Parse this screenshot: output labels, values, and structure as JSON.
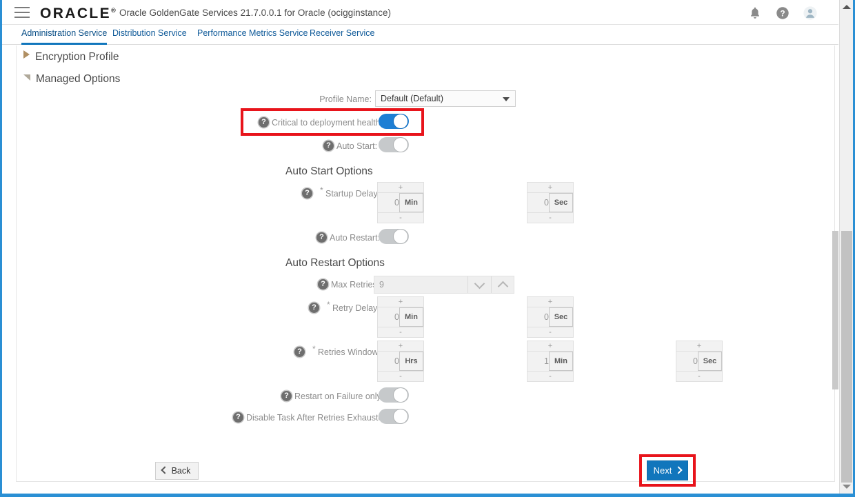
{
  "header": {
    "menu_icon": "hamburger-icon",
    "brand": "ORACLE",
    "brand_sup": "®",
    "title": "Oracle GoldenGate Services 21.7.0.0.1 for Oracle (ocigginstance)",
    "icons": [
      {
        "name": "notifications-bell-icon",
        "glyph": "bell"
      },
      {
        "name": "help-icon",
        "glyph": "question"
      },
      {
        "name": "user-avatar-icon",
        "glyph": "avatar"
      }
    ]
  },
  "tabs": [
    {
      "label": "Administration Service",
      "active": true
    },
    {
      "label": "Distribution Service",
      "active": false
    },
    {
      "label": "Performance Metrics Service",
      "active": false
    },
    {
      "label": "Receiver Service",
      "active": false
    }
  ],
  "accordions": [
    {
      "label": "Encryption Profile",
      "state": "collapsed"
    },
    {
      "label": "Managed Options",
      "state": "expanded"
    }
  ],
  "form": {
    "profile_name": {
      "label": "Profile Name:",
      "value": "Default (Default)"
    },
    "critical_health": {
      "label": "Critical to deployment health:",
      "state": "on"
    },
    "auto_start": {
      "label": "Auto Start:",
      "state": "off"
    },
    "auto_start_options": {
      "section_title": "Auto Start Options",
      "startup_delay": {
        "label": "Startup Delay:",
        "required": "*",
        "fields": [
          {
            "value": "0",
            "unit": "Min",
            "plus": "+",
            "minus": "-"
          },
          {
            "value": "0",
            "unit": "Sec",
            "plus": "+",
            "minus": "-"
          }
        ]
      },
      "auto_restart": {
        "label": "Auto Restart:",
        "state": "off"
      }
    },
    "auto_restart_options": {
      "section_title": "Auto Restart Options",
      "max_retries": {
        "label": "Max Retries:",
        "value": "9"
      },
      "retry_delay": {
        "label": "Retry Delay:",
        "required": "*",
        "fields": [
          {
            "value": "0",
            "unit": "Min",
            "plus": "+",
            "minus": "-"
          },
          {
            "value": "0",
            "unit": "Sec",
            "plus": "+",
            "minus": "-"
          }
        ]
      },
      "retries_window": {
        "label": "Retries Window:",
        "required": "*",
        "fields": [
          {
            "value": "0",
            "unit": "Hrs",
            "plus": "+",
            "minus": "-"
          },
          {
            "value": "1",
            "unit": "Min",
            "plus": "+",
            "minus": "-"
          },
          {
            "value": "0",
            "unit": "Sec",
            "plus": "+",
            "minus": "-"
          }
        ]
      },
      "restart_on_failure_only": {
        "label": "Restart on Failure only:",
        "state": "off"
      },
      "disable_task_after_retries": {
        "label": "Disable Task After Retries Exhausted:",
        "state": "off"
      }
    }
  },
  "footer": {
    "back_label": "Back",
    "next_label": "Next"
  },
  "colors": {
    "accent_blue": "#1176bc",
    "toggle_on": "#1e7fd4",
    "toggle_off": "#c6c9cb",
    "annotation_red": "#e8141b",
    "window_border": "#2a8fd4",
    "link_blue": "#0f5a99"
  },
  "help_glyph": "?"
}
